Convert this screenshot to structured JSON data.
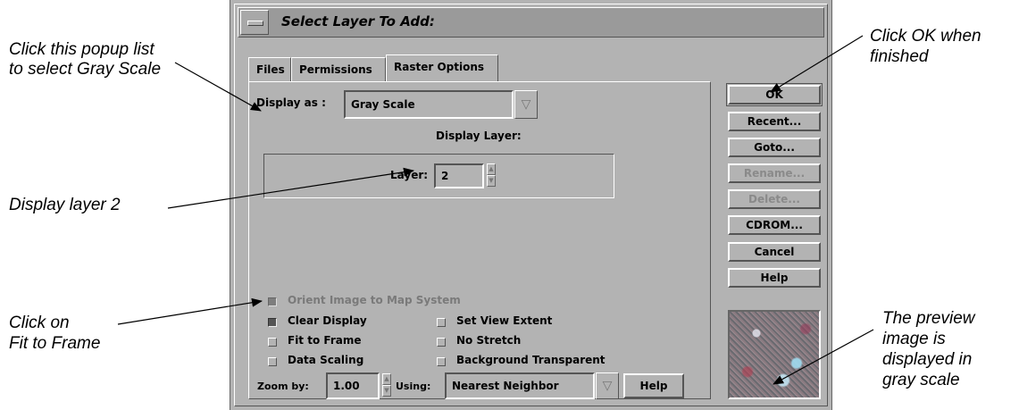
{
  "annotations": {
    "popup_line1": "Click this popup list",
    "popup_line2": "to select Gray Scale",
    "layer": "Display layer 2",
    "fit_line1": "Click on",
    "fit_line2": "Fit to Frame",
    "ok_line1": "Click OK when",
    "ok_line2": "finished",
    "preview_line1": "The preview",
    "preview_line2": "image is",
    "preview_line3": "displayed in",
    "preview_line4": "gray scale"
  },
  "window": {
    "title": "Select Layer To Add:"
  },
  "tabs": [
    {
      "label": "Files",
      "active": false
    },
    {
      "label": "Permissions",
      "active": false
    },
    {
      "label": "Raster Options",
      "active": true
    }
  ],
  "raster_options": {
    "display_as_label": "Display as :",
    "display_as_value": "Gray Scale",
    "display_layer_heading": "Display Layer:",
    "layer_label": "Layer:",
    "layer_value": "2",
    "checkboxes": {
      "orient": {
        "label": "Orient Image to Map System",
        "checked": true,
        "enabled": false
      },
      "clear_display": {
        "label": "Clear Display",
        "checked": true,
        "enabled": true
      },
      "fit_to_frame": {
        "label": "Fit to Frame",
        "checked": false,
        "enabled": true
      },
      "data_scaling": {
        "label": "Data Scaling",
        "checked": false,
        "enabled": true
      },
      "set_view_extent": {
        "label": "Set View Extent",
        "checked": false,
        "enabled": true
      },
      "no_stretch": {
        "label": "No Stretch",
        "checked": false,
        "enabled": true
      },
      "background_transparent": {
        "label": "Background Transparent",
        "checked": false,
        "enabled": true
      }
    },
    "zoom_label": "Zoom by:",
    "zoom_value": "1.00",
    "using_label": "Using:",
    "using_value": "Nearest Neighbor",
    "help_label": "Help"
  },
  "side_buttons": {
    "ok": "OK",
    "recent": "Recent...",
    "goto": "Goto...",
    "rename": "Rename...",
    "delete": "Delete...",
    "cdrom": "CDROM...",
    "cancel": "Cancel",
    "help": "Help"
  },
  "colors": {
    "dialog_bg": "#b3b3b3",
    "titlebar_bg": "#9a9a9a"
  },
  "icons": {
    "window_menu": "window-menu-icon",
    "dropdown": "triangle-down-icon",
    "spinner": "spin-up-down-icon"
  }
}
